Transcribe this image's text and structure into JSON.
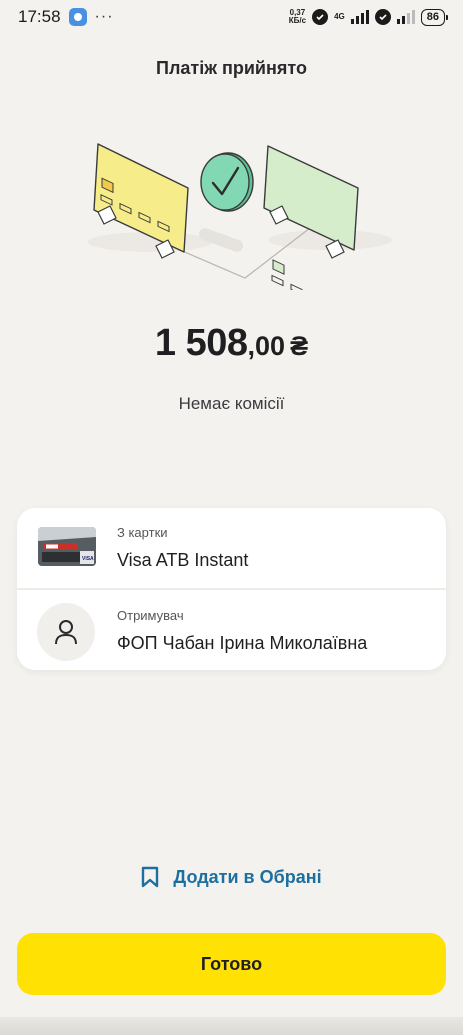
{
  "status_bar": {
    "time": "17:58",
    "dots": "···",
    "net_speed_value": "0,37",
    "net_speed_unit": "КБ/с",
    "net_type": "4G",
    "battery": "86"
  },
  "header": {
    "title": "Платіж прийнято"
  },
  "payment": {
    "amount_integer": "1 508",
    "amount_decimal": ",00",
    "currency": "₴",
    "commission": "Немає комісії"
  },
  "details": {
    "from": {
      "label": "З картки",
      "value": "Visa ATB Instant"
    },
    "recipient": {
      "label": "Отримувач",
      "value": "ФОП Чабан Ірина Миколаївна"
    }
  },
  "actions": {
    "favorites_label": "Додати в Обрані",
    "done_label": "Готово"
  },
  "icons": {
    "favorites": "bookmark-icon",
    "recipient": "person-icon",
    "status": "checkmark-icon"
  },
  "colors": {
    "accent_yellow": "#ffe104",
    "link_blue": "#1d6fa0",
    "card_yellow": "#f7ec8a",
    "card_green": "#d5edcb",
    "check_green": "#7fd6b0",
    "background": "#f4f2ee"
  }
}
